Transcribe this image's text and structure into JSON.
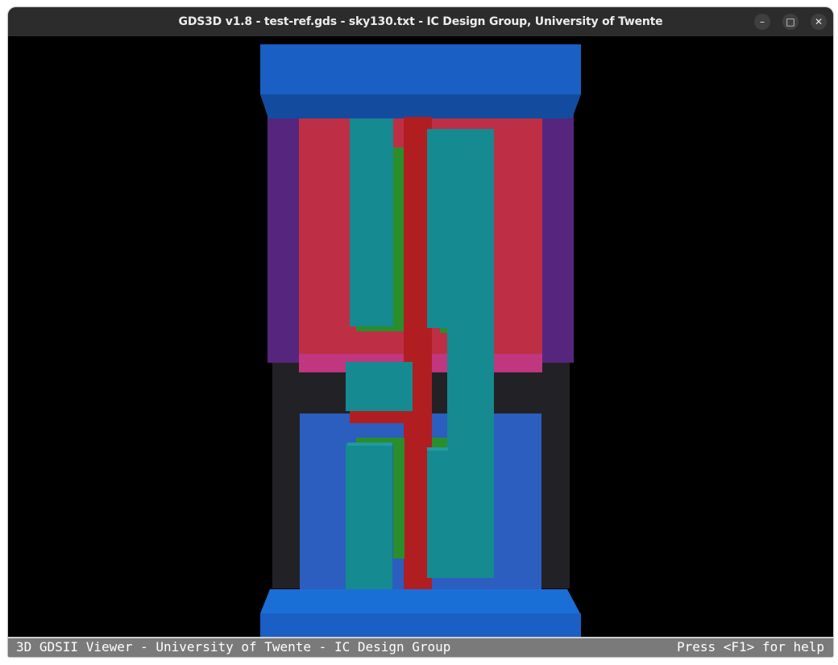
{
  "window": {
    "title": "GDS3D v1.8 - test-ref.gds - sky130.txt - IC Design Group, University of Twente",
    "controls": {
      "minimize": "–",
      "maximize": "□",
      "close": "✕"
    }
  },
  "statusbar": {
    "left_text": "3D GDSII Viewer - University of Twente - IC Design Group",
    "right_text": "Press <F1> for help"
  },
  "colors": {
    "background": "#000000",
    "metal1_teal": "#158a90",
    "poly_red": "#b01e22",
    "diffusion_green": "#2a8e2a",
    "nwell_purple": "#56267f",
    "pdiff_red": "#be2f45",
    "pdiff_pink": "#c0367f",
    "ndiff_blue": "#2b5ebe",
    "metal_rail_blue": "#1a5fc4",
    "substrate_gray": "#222226"
  }
}
